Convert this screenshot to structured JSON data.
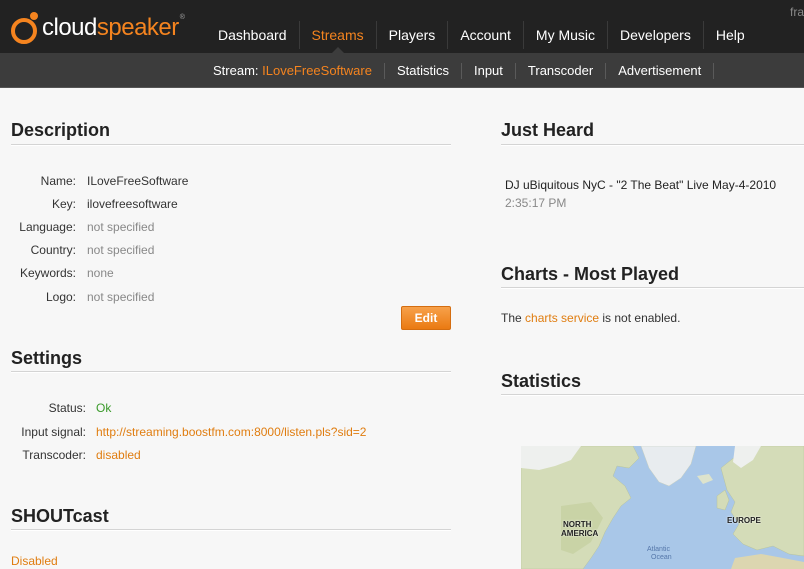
{
  "header": {
    "logo": {
      "part_white": "cloud",
      "part_orange": "speaker",
      "trademark": "®"
    },
    "user_fragment": "fra",
    "nav": [
      {
        "label": "Dashboard",
        "active": false
      },
      {
        "label": "Streams",
        "active": true
      },
      {
        "label": "Players",
        "active": false
      },
      {
        "label": "Account",
        "active": false
      },
      {
        "label": "My Music",
        "active": false
      },
      {
        "label": "Developers",
        "active": false
      },
      {
        "label": "Help",
        "active": false
      }
    ]
  },
  "subnav": {
    "stream_prefix": "Stream: ",
    "stream_name": "ILoveFreeSoftware",
    "items": [
      "Statistics",
      "Input",
      "Transcoder",
      "Advertisement"
    ]
  },
  "description": {
    "title": "Description",
    "fields": [
      {
        "label": "Name:",
        "value": "ILoveFreeSoftware"
      },
      {
        "label": "Key:",
        "value": "ilovefreesoftware"
      },
      {
        "label": "Language:",
        "value": "not specified"
      },
      {
        "label": "Country:",
        "value": "not specified"
      },
      {
        "label": "Keywords:",
        "value": "none"
      },
      {
        "label": "Logo:",
        "value": "not specified"
      }
    ],
    "edit_label": "Edit"
  },
  "settings": {
    "title": "Settings",
    "fields": [
      {
        "label": "Status:",
        "value": "Ok"
      },
      {
        "label": "Input signal:",
        "value": "http://streaming.boostfm.com:8000/listen.pls?sid=2"
      },
      {
        "label": "Transcoder:",
        "value": "disabled"
      }
    ]
  },
  "shoutcast": {
    "title": "SHOUTcast",
    "status": "Disabled"
  },
  "just_heard": {
    "title": "Just Heard",
    "track": "DJ uBiquitous NyC - \"2 The Beat\" Live May-4-2010",
    "time": "2:35:17 PM"
  },
  "charts": {
    "title": "Charts - Most Played",
    "msg_before": "The ",
    "msg_link": "charts service",
    "msg_after": " is not enabled."
  },
  "statistics": {
    "title": "Statistics",
    "map": {
      "labels": [
        "NORTH",
        "AMERICA",
        "EUROPE"
      ],
      "ocean": [
        "Atlantic",
        "Ocean"
      ]
    }
  },
  "colors": {
    "accent": "#f5841f",
    "topbar": "#222222",
    "subbar": "#3c3c3c",
    "status_ok": "#3a9a2a",
    "link": "#e07d10"
  }
}
